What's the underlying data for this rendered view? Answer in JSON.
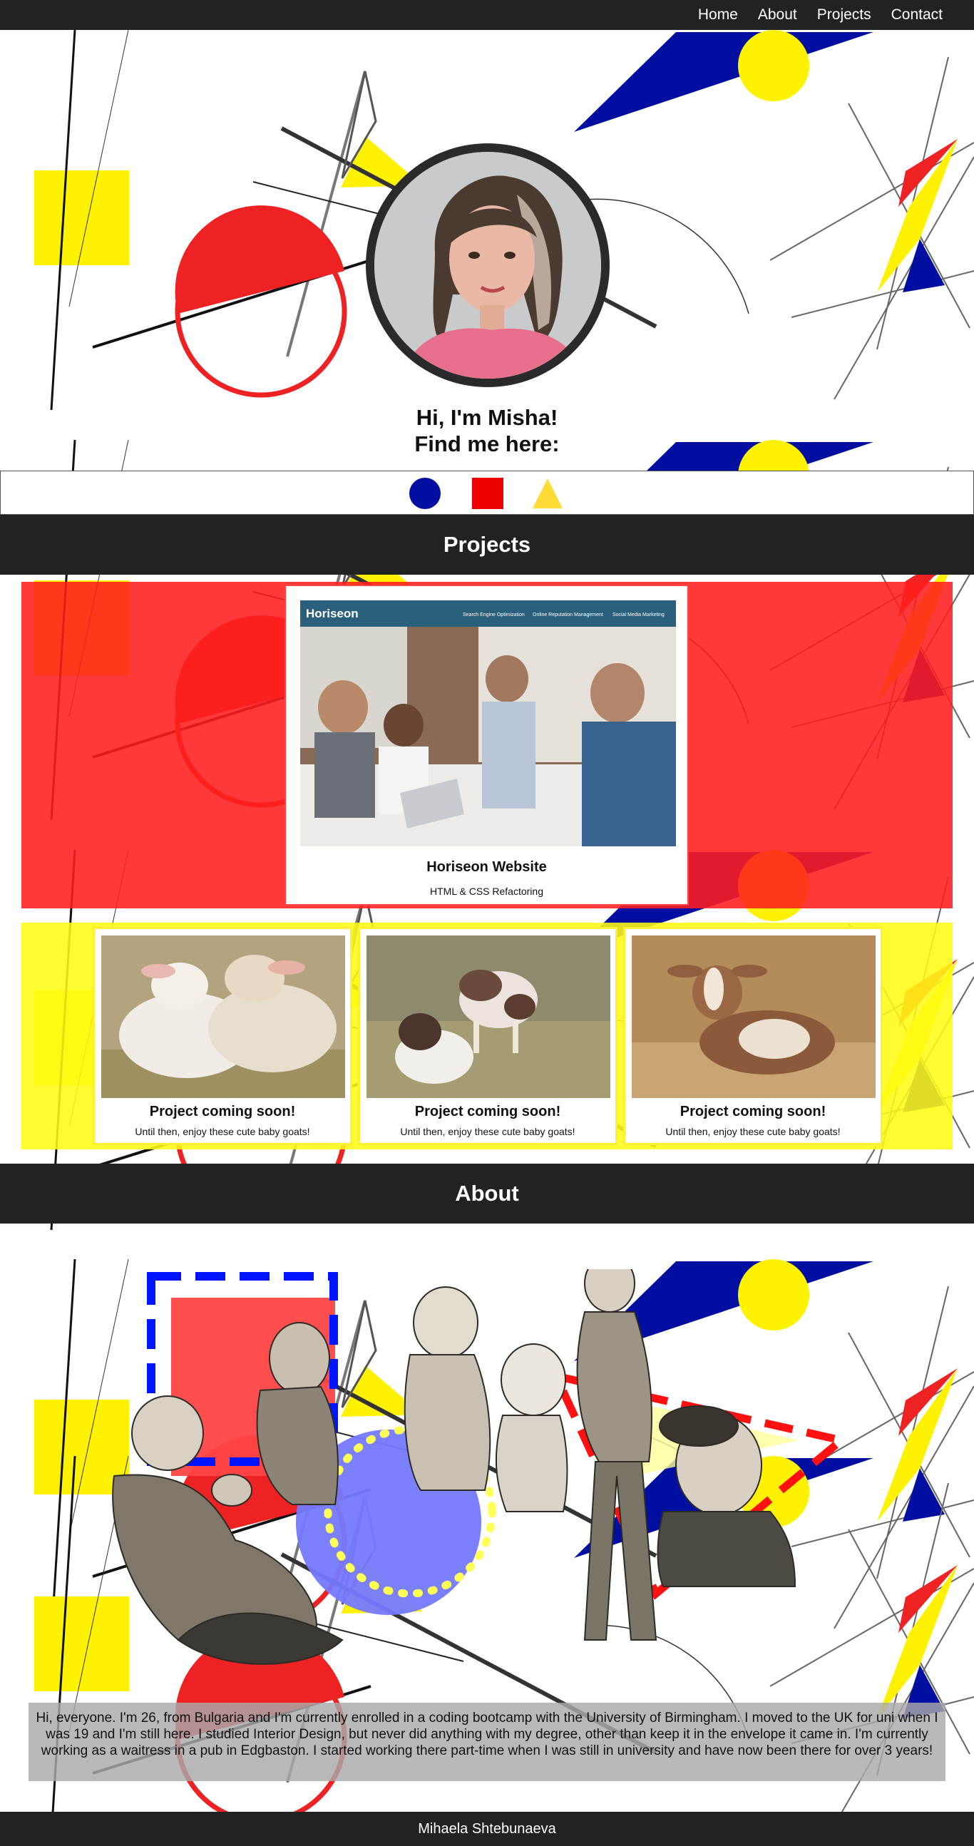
{
  "nav": {
    "items": [
      {
        "label": "Home"
      },
      {
        "label": "About"
      },
      {
        "label": "Projects"
      },
      {
        "label": "Contact"
      }
    ]
  },
  "hero": {
    "greeting_line1": "Hi, I'm Misha!",
    "greeting_line2": "Find me here:",
    "social_icons": [
      "blue-circle-icon",
      "red-square-icon",
      "yellow-triangle-icon"
    ]
  },
  "projects": {
    "heading": "Projects",
    "featured": {
      "title": "Horiseon Website",
      "subtitle": "HTML & CSS Refactoring",
      "screenshot": {
        "brand": "Horiseon",
        "nav_links": [
          "Search Engine Optimization",
          "Online Reputation Management",
          "Social Media Marketing"
        ]
      }
    },
    "placeholders": [
      {
        "title": "Project coming soon!",
        "subtitle": "Until then, enjoy these cute baby goats!"
      },
      {
        "title": "Project coming soon!",
        "subtitle": "Until then, enjoy these cute baby goats!"
      },
      {
        "title": "Project coming soon!",
        "subtitle": "Until then, enjoy these cute baby goats!"
      }
    ]
  },
  "about": {
    "heading": "About",
    "bio": "Hi, everyone. I'm 26, from Bulgaria and I'm currently enrolled in a coding bootcamp with the University of Birmingham. I moved to the UK for uni when I was 19 and I'm still here. I studied Interior Design, but never did anything with my degree, other than keep it in the envelope it came in. I'm currently working as a waitress in a pub in Edgbaston. I started working there part-time when I was still in university and have now been there for over 3 years!"
  },
  "footer": {
    "name": "Mihaela Shtebunaeva"
  },
  "colors": {
    "dark": "#212322",
    "red": "#ee2222",
    "yellow": "#fff200",
    "blue": "#000fa0"
  }
}
